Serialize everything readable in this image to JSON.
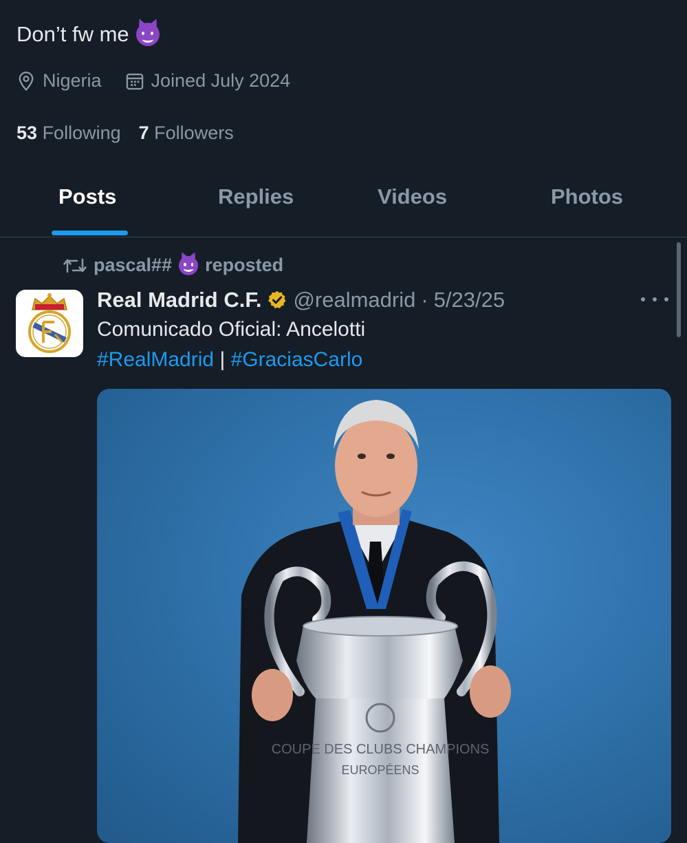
{
  "profile": {
    "bio": "Don’t fw me",
    "location": "Nigeria",
    "joined": "Joined July 2024",
    "following_count": "53",
    "following_label": "Following",
    "followers_count": "7",
    "followers_label": "Followers"
  },
  "tabs": [
    {
      "label": "Posts",
      "active": true
    },
    {
      "label": "Replies",
      "active": false
    },
    {
      "label": "Videos",
      "active": false
    },
    {
      "label": "Photos",
      "active": false
    }
  ],
  "post": {
    "reposter": "pascal##",
    "repost_label": "reposted",
    "author_name": "Real Madrid C.F.",
    "handle": "@realmadrid",
    "separator": "·",
    "date": "5/23/25",
    "text": "Comunicado Oficial: Ancelotti",
    "hashtag1": "#RealMadrid",
    "divider": "|",
    "hashtag2": "#GraciasCarlo",
    "image_text_line1": "COUPE DES CLUBS CHAMPIONS",
    "image_text_line2": "EUROPÉENS"
  },
  "colors": {
    "background": "#151d27",
    "accent": "#1d9bf0",
    "muted_text": "#8b98a5",
    "verified_badge": "#e8b623",
    "emoji_purple": "#8b46c5"
  },
  "icons": {
    "location": "location-pin-icon",
    "calendar": "calendar-icon",
    "repost": "repost-icon",
    "verified": "verified-badge-icon",
    "more": "more-options-icon",
    "emoji": "smiling-imp-emoji"
  }
}
